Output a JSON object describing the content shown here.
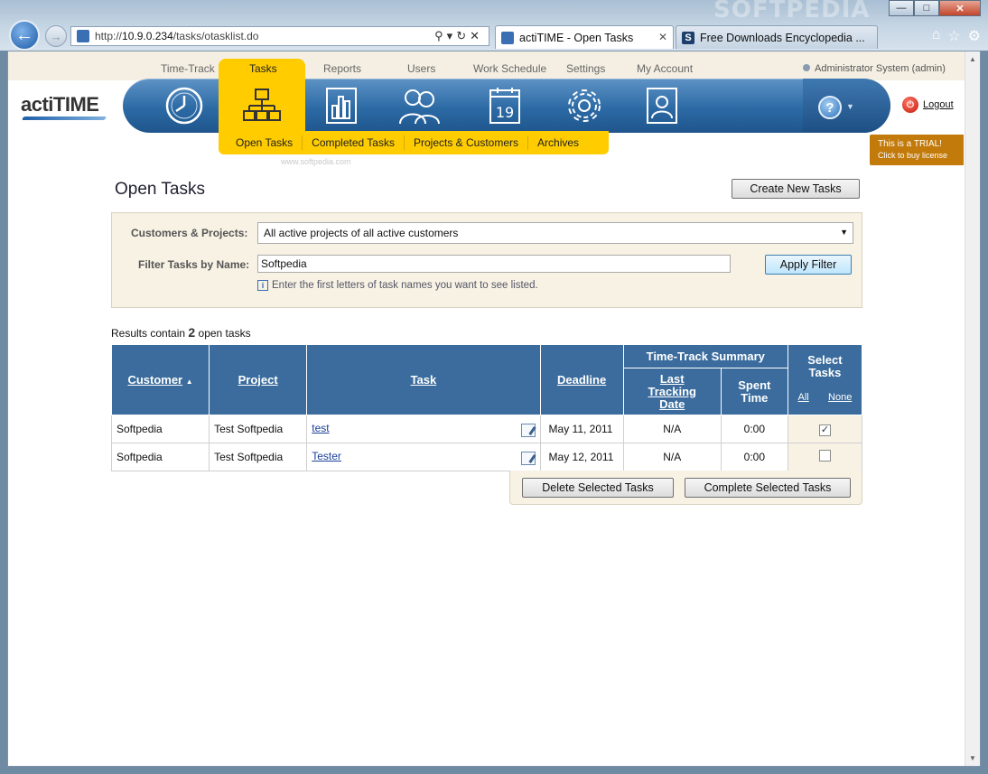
{
  "browser": {
    "url_prefix": "http://",
    "url_host": "10.9.0.234",
    "url_path": "/tasks/otasklist.do",
    "tabs": [
      {
        "label": "actiTIME - Open Tasks"
      },
      {
        "label": "Free Downloads Encyclopedia ..."
      }
    ],
    "watermark": "SOFTPEDIA"
  },
  "app": {
    "logo": "actiTIME",
    "top_nav": [
      "Time-Track",
      "Tasks",
      "Reports",
      "Users",
      "Work Schedule",
      "Settings",
      "My Account"
    ],
    "user": "Administrator System (admin)",
    "logout": "Logout",
    "sub_nav": [
      "Open Tasks",
      "Completed Tasks",
      "Projects & Customers",
      "Archives"
    ],
    "sub_watermark": "www.softpedia.com",
    "trial_line1": "This is a TRIAL!",
    "trial_line2": "Click to buy license"
  },
  "page": {
    "title": "Open Tasks",
    "create_button": "Create New Tasks"
  },
  "filter": {
    "customers_label": "Customers & Projects:",
    "customers_value": "All active projects of all active customers",
    "name_label": "Filter Tasks by Name:",
    "name_value": "Softpedia",
    "apply_button": "Apply Filter",
    "hint": "Enter the first letters of task names you want to see listed."
  },
  "results": {
    "prefix": "Results contain",
    "count": "2",
    "suffix": "open tasks"
  },
  "table": {
    "headers": {
      "customer": "Customer",
      "project": "Project",
      "task": "Task",
      "deadline": "Deadline",
      "summary": "Time-Track Summary",
      "last_tracking": "Last Tracking Date",
      "spent": "Spent Time",
      "select": "Select Tasks",
      "all": "All",
      "none": "None"
    },
    "rows": [
      {
        "customer": "Softpedia",
        "project": "Test Softpedia",
        "task": "test",
        "deadline": "May 11, 2011",
        "last_tracking": "N/A",
        "spent": "0:00",
        "selected": "✓"
      },
      {
        "customer": "Softpedia",
        "project": "Test Softpedia",
        "task": "Tester",
        "deadline": "May 12, 2011",
        "last_tracking": "N/A",
        "spent": "0:00",
        "selected": ""
      }
    ]
  },
  "actions": {
    "delete": "Delete Selected Tasks",
    "complete": "Complete Selected Tasks"
  }
}
